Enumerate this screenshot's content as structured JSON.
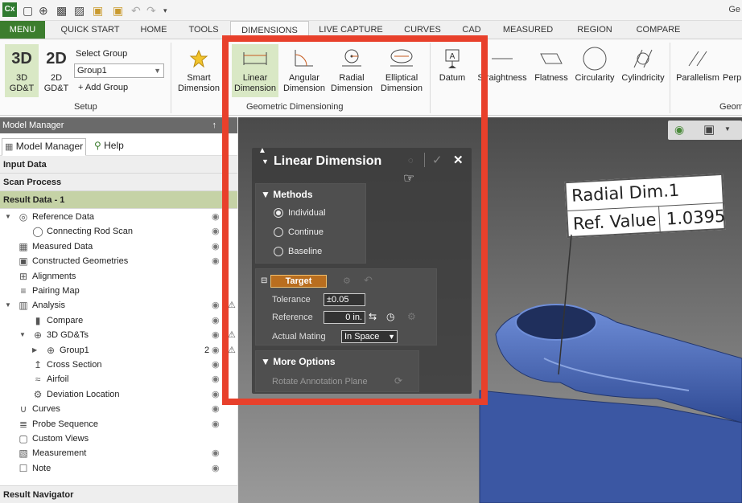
{
  "app": {
    "logo": "Cx",
    "title": "Ge"
  },
  "quick_access_icons": [
    "new-icon",
    "add-icon",
    "save-icon",
    "save-as-icon",
    "open-icon",
    "open-recent-icon",
    "undo-icon",
    "redo-icon",
    "customize-icon"
  ],
  "ribbon_tabs": [
    "MENU",
    "QUICK START",
    "HOME",
    "TOOLS",
    "DIMENSIONS",
    "LIVE CAPTURE",
    "CURVES",
    "CAD",
    "MEASURED",
    "REGION",
    "COMPARE"
  ],
  "active_tab": "DIMENSIONS",
  "ribbon": {
    "setup": {
      "btn_3d_big": "3D",
      "btn_3d_label": "3D GD&T",
      "btn_2d_big": "2D",
      "btn_2d_label": "2D GD&T",
      "select_group_label": "Select Group",
      "group_value": "Group1",
      "add_group_label": "+ Add Group",
      "group_label": "Setup"
    },
    "smart": {
      "label1": "Smart",
      "label2": "Dimension"
    },
    "geometric": {
      "linear1": "Linear",
      "linear2": "Dimension",
      "angular1": "Angular",
      "angular2": "Dimension",
      "radial1": "Radial",
      "radial2": "Dimension",
      "elliptical1": "Elliptical",
      "elliptical2": "Dimension",
      "group_label": "Geometric Dimensioning"
    },
    "datum": "Datum",
    "straightness": "Straightness",
    "flatness": "Flatness",
    "circularity": "Circularity",
    "cylindricity": "Cylindricity",
    "parallelism": "Parallelism",
    "perp": "Perp",
    "geom_group_label": "Geom"
  },
  "model_manager": {
    "title": "Model Manager",
    "pin": "↑",
    "tab_model_manager": "Model Manager",
    "tab_help": "Help",
    "input_data": "Input Data",
    "scan_process": "Scan Process",
    "result_data": "Result Data - 1",
    "tree": [
      {
        "label": "Reference Data",
        "depth": 0
      },
      {
        "label": "Connecting Rod Scan",
        "depth": 1
      },
      {
        "label": "Measured Data",
        "depth": 0
      },
      {
        "label": "Constructed Geometries",
        "depth": 0
      },
      {
        "label": "Alignments",
        "depth": 0
      },
      {
        "label": "Pairing Map",
        "depth": 0
      },
      {
        "label": "Analysis",
        "depth": 0
      },
      {
        "label": "Compare",
        "depth": 1
      },
      {
        "label": "3D GD&Ts",
        "depth": 1
      },
      {
        "label": "Group1",
        "depth": 2,
        "count": "2"
      },
      {
        "label": "Cross Section",
        "depth": 1
      },
      {
        "label": "Airfoil",
        "depth": 1
      },
      {
        "label": "Deviation Location",
        "depth": 1
      },
      {
        "label": "Curves",
        "depth": 0
      },
      {
        "label": "Probe Sequence",
        "depth": 0
      },
      {
        "label": "Custom Views",
        "depth": 0
      },
      {
        "label": "Measurement",
        "depth": 0
      },
      {
        "label": "Note",
        "depth": 0
      }
    ],
    "result_navigator": "Result Navigator"
  },
  "dialog": {
    "title": "Linear Dimension",
    "methods_title": "Methods",
    "method_individual": "Individual",
    "method_continue": "Continue",
    "method_baseline": "Baseline",
    "target_label": "Target",
    "tolerance_label": "Tolerance",
    "tolerance_value": "±0.05",
    "reference_label": "Reference",
    "reference_value": "0 in.",
    "actual_mating_label": "Actual Mating",
    "actual_mating_value": "In Space",
    "more_options_title": "More Options",
    "rotate_plane_label": "Rotate Annotation Plane"
  },
  "annotation": {
    "title": "Radial Dim.1",
    "ref_label": "Ref. Value",
    "ref_value": "1.0395"
  },
  "colors": {
    "menu_tab": "#3c7d2e",
    "highlight_box": "#e8402b",
    "model": "#5577c8",
    "section_green": "#c5d2a6"
  }
}
